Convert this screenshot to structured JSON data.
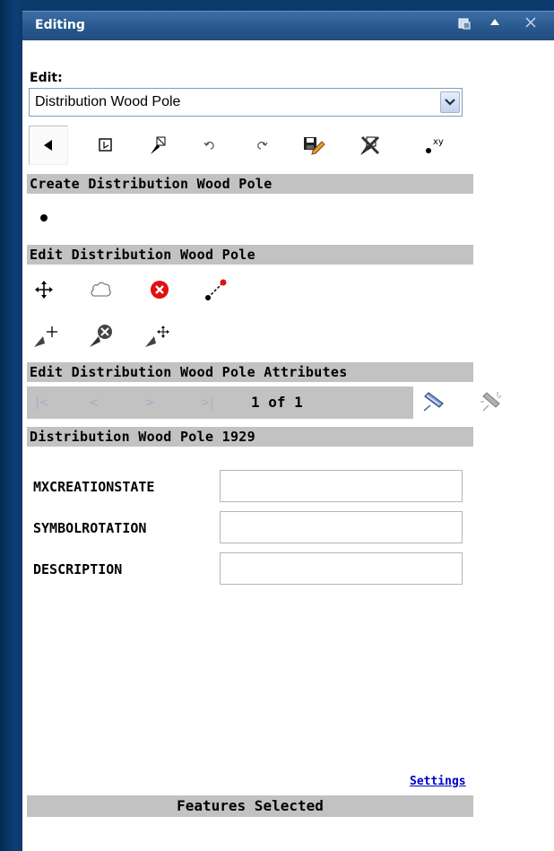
{
  "window": {
    "title": "Editing",
    "icons": [
      "dock-icon",
      "collapse-icon",
      "close-icon"
    ]
  },
  "edit_label": "Edit:",
  "layer_select": {
    "value": "Distribution Wood Pole"
  },
  "toolbar": {
    "tools": [
      "select-arrow-icon",
      "select-box-icon",
      "clear-selection-icon",
      "undo-icon",
      "redo-icon",
      "save-edits-icon",
      "delete-selected-icon",
      "add-xy-icon"
    ]
  },
  "create_section": {
    "title": "Create Distribution Wood Pole",
    "tools": [
      "point-icon"
    ]
  },
  "edit_section": {
    "title": "Edit Distribution Wood Pole",
    "row1": [
      "move-icon",
      "edit-vertices-icon",
      "delete-feature-icon",
      "split-line-icon"
    ],
    "row2": [
      "add-vertex-icon",
      "delete-vertex-icon",
      "move-vertex-icon"
    ]
  },
  "attributes_section": {
    "title": "Edit Distribution Wood Pole Attributes",
    "pager": {
      "first": "|<",
      "prev": "<",
      "next": ">",
      "last": ">|",
      "count": "1 of 1"
    },
    "feature_title": "Distribution Wood Pole 1929",
    "fields": [
      {
        "label": "MXCREATIONSTATE",
        "value": ""
      },
      {
        "label": "SYMBOLROTATION",
        "value": ""
      },
      {
        "label": "DESCRIPTION",
        "value": ""
      }
    ]
  },
  "settings_link": "Settings",
  "footer": "Features Selected",
  "colors": {
    "title_bar": "#2a5a90",
    "section_bg": "#c2c2c2",
    "link": "#0000cc",
    "delete_red": "#e01010"
  }
}
